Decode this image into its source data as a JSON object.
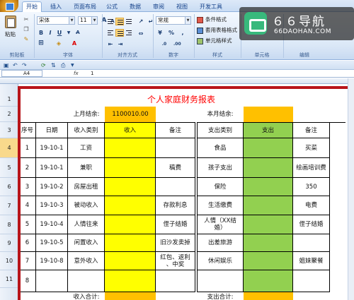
{
  "ribbon": {
    "tabs": [
      "开始",
      "插入",
      "页面布局",
      "公式",
      "数据",
      "审阅",
      "视图",
      "开发工具"
    ],
    "clipboard": {
      "paste_label": "粘贴",
      "group_label": "剪贴板"
    },
    "font": {
      "name": "宋体",
      "size": "11",
      "group_label": "字体"
    },
    "alignment": {
      "group_label": "对齐方式"
    },
    "number": {
      "format": "常规",
      "group_label": "数字"
    },
    "styles": {
      "conditional": "条件格式",
      "table": "套用表格格式",
      "cell": "单元格样式",
      "group_label": "样式"
    },
    "cells": {
      "group_label": "单元格"
    },
    "editing": {
      "group_label": "编辑"
    }
  },
  "formula_bar": {
    "name_box": "A4",
    "fx": "fx",
    "value": "1"
  },
  "sheet": {
    "title": "个人家庭财务报表",
    "last_month_label": "上月结余:",
    "last_month_value": "1100010.00",
    "this_month_label": "本月结余:",
    "income_total_label": "收入合计:",
    "expense_total_label": "支出合计:",
    "row_numbers": [
      "1",
      "2",
      "3",
      "4",
      "5",
      "6",
      "7",
      "8",
      "9",
      "10",
      "11"
    ],
    "headers": {
      "no": "序号",
      "date": "日期",
      "income_cat": "收入类别",
      "income": "收入",
      "note": "备注",
      "expense_cat": "支出类别",
      "expense": "支出",
      "note2": "备注"
    },
    "rows": [
      {
        "no": "1",
        "date": "19-10-1",
        "cat": "工资",
        "note": "",
        "ecat": "食品",
        "enote": "买菜"
      },
      {
        "no": "2",
        "date": "19-10-1",
        "cat": "兼职",
        "note": "稿费",
        "ecat": "孩子支出",
        "enote": "绘画培训费"
      },
      {
        "no": "3",
        "date": "19-10-2",
        "cat": "房屋出租",
        "note": "",
        "ecat": "保险",
        "enote": "350"
      },
      {
        "no": "4",
        "date": "19-10-3",
        "cat": "被动收入",
        "note": "存款利息",
        "ecat": "生活缴费",
        "enote": "电费"
      },
      {
        "no": "5",
        "date": "19-10-4",
        "cat": "人情往来",
        "note": "侄子结婚",
        "ecat": "人情（XX结\n婚）",
        "enote": "侄子结婚"
      },
      {
        "no": "6",
        "date": "19-10-5",
        "cat": "闲置收入",
        "note": "旧沙发卖掉",
        "ecat": "出差旅游",
        "enote": ""
      },
      {
        "no": "7",
        "date": "19-10-8",
        "cat": "意外收入",
        "note": "红包、返利\n、中奖",
        "ecat": "休闲娱乐",
        "enote": "姐妹聚餐"
      },
      {
        "no": "8",
        "date": "",
        "cat": "",
        "note": "",
        "ecat": "",
        "enote": ""
      }
    ]
  },
  "watermark": {
    "title": "６６导航",
    "subtitle": "66DAOHAN.COM"
  },
  "colors": {
    "yellow": "#ffff00",
    "orange": "#ffc000",
    "green": "#92d050",
    "frame": "#b8141a",
    "title": "#ff0000"
  }
}
